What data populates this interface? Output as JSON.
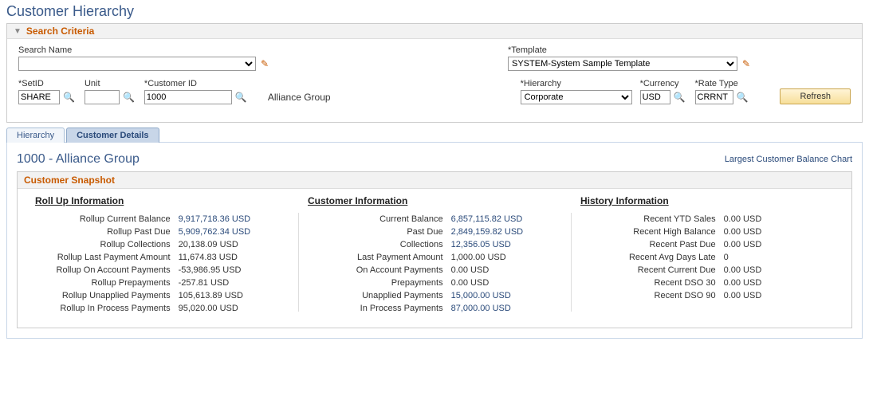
{
  "page_title": "Customer Hierarchy",
  "search": {
    "header": "Search Criteria",
    "search_name_label": "Search Name",
    "search_name_value": "",
    "template_label": "Template",
    "template_value": "SYSTEM-System Sample Template",
    "setid_label": "SetID",
    "setid_value": "SHARE",
    "unit_label": "Unit",
    "unit_value": "",
    "customer_id_label": "Customer ID",
    "customer_id_value": "1000",
    "customer_name_display": "Alliance Group",
    "hierarchy_label": "Hierarchy",
    "hierarchy_value": "Corporate",
    "currency_label": "Currency",
    "currency_value": "USD",
    "rate_type_label": "Rate Type",
    "rate_type_value": "CRRNT",
    "refresh_button": "Refresh"
  },
  "tabs": {
    "hierarchy": "Hierarchy",
    "customer_details": "Customer Details"
  },
  "details": {
    "title": "1000 - Alliance Group",
    "chart_link": "Largest Customer Balance Chart",
    "snapshot_header": "Customer Snapshot",
    "rollup": {
      "heading": "Roll Up Information",
      "rows": [
        {
          "label": "Rollup Current Balance",
          "value": "9,917,718.36 USD",
          "link": true
        },
        {
          "label": "Rollup Past Due",
          "value": "5,909,762.34 USD",
          "link": true
        },
        {
          "label": "Rollup Collections",
          "value": "20,138.09 USD",
          "link": false
        },
        {
          "label": "Rollup Last Payment Amount",
          "value": "11,674.83 USD",
          "link": false
        },
        {
          "label": "Rollup On Account Payments",
          "value": "-53,986.95 USD",
          "link": false
        },
        {
          "label": "Rollup Prepayments",
          "value": "-257.81 USD",
          "link": false
        },
        {
          "label": "Rollup Unapplied Payments",
          "value": "105,613.89 USD",
          "link": false
        },
        {
          "label": "Rollup In Process Payments",
          "value": "95,020.00 USD",
          "link": false
        }
      ]
    },
    "customer": {
      "heading": "Customer Information",
      "rows": [
        {
          "label": "Current Balance",
          "value": "6,857,115.82 USD",
          "link": true
        },
        {
          "label": "Past Due",
          "value": "2,849,159.82 USD",
          "link": true
        },
        {
          "label": "Collections",
          "value": "12,356.05 USD",
          "link": true
        },
        {
          "label": "Last Payment Amount",
          "value": "1,000.00 USD",
          "link": false
        },
        {
          "label": "On Account Payments",
          "value": "0.00 USD",
          "link": false
        },
        {
          "label": "Prepayments",
          "value": "0.00 USD",
          "link": false
        },
        {
          "label": "Unapplied Payments",
          "value": "15,000.00 USD",
          "link": true
        },
        {
          "label": "In Process Payments",
          "value": "87,000.00 USD",
          "link": true
        }
      ]
    },
    "history": {
      "heading": "History Information",
      "rows": [
        {
          "label": "Recent YTD Sales",
          "value": "0.00 USD",
          "link": false
        },
        {
          "label": "Recent High Balance",
          "value": "0.00 USD",
          "link": false
        },
        {
          "label": "Recent Past Due",
          "value": "0.00 USD",
          "link": false
        },
        {
          "label": "Recent Avg Days Late",
          "value": "0",
          "link": false
        },
        {
          "label": "Recent Current Due",
          "value": "0.00 USD",
          "link": false
        },
        {
          "label": "Recent DSO 30",
          "value": "0.00 USD",
          "link": false
        },
        {
          "label": "Recent DSO 90",
          "value": "0.00 USD",
          "link": false
        }
      ]
    }
  }
}
